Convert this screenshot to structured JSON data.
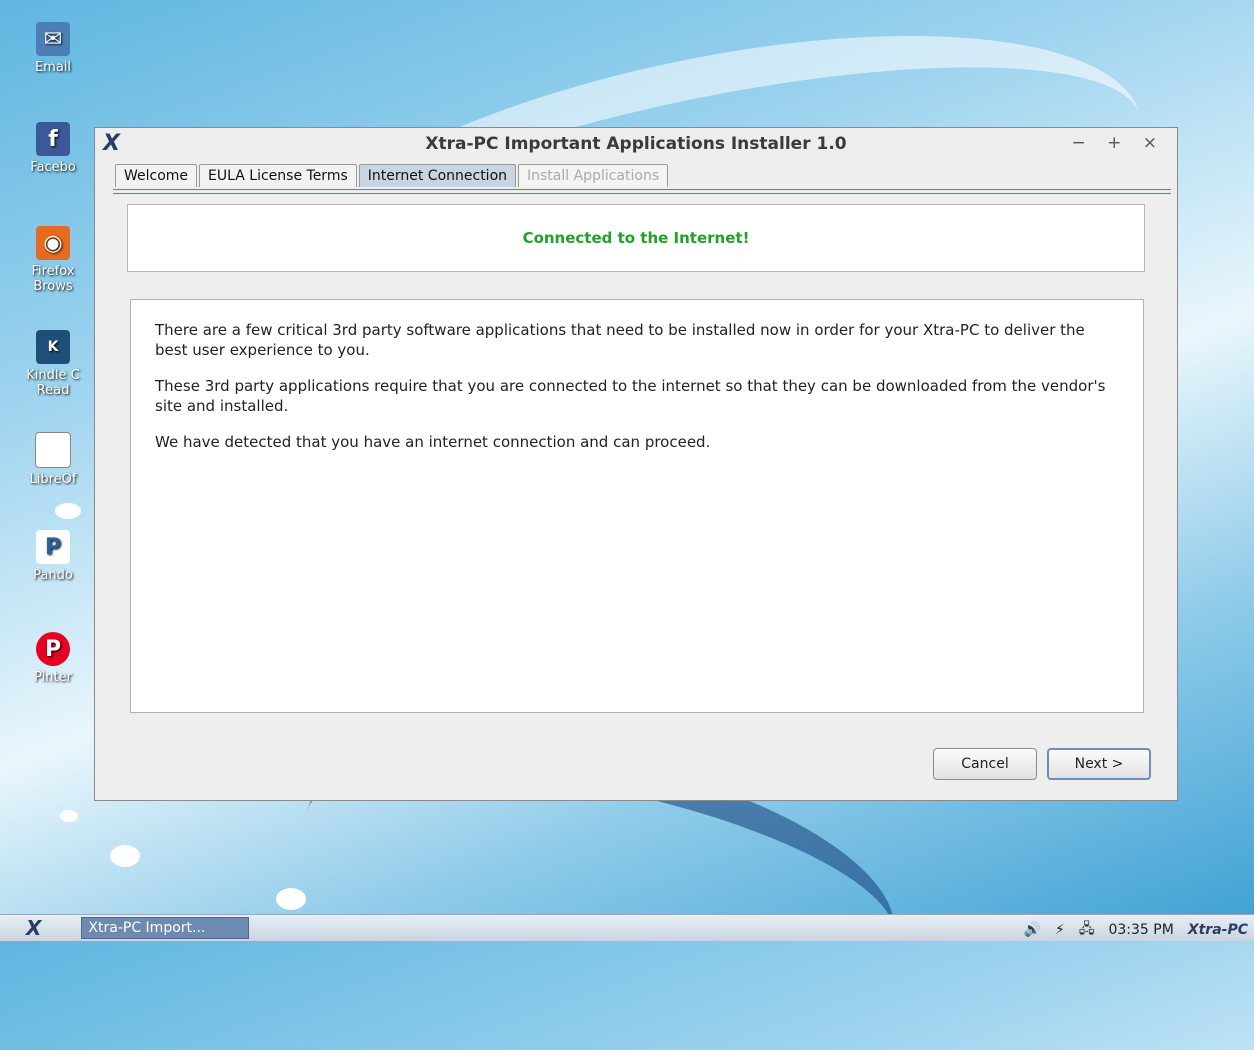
{
  "desktop": {
    "icons": [
      {
        "label": "Email",
        "icon": "email-icon"
      },
      {
        "label": "Facebo",
        "icon": "facebook-icon"
      },
      {
        "label": "Firefox\nBrows",
        "icon": "firefox-icon"
      },
      {
        "label": "Kindle C\nRead",
        "icon": "kindle-icon"
      },
      {
        "label": "LibreOf",
        "icon": "libreoffice-icon"
      },
      {
        "label": "Pando",
        "icon": "pandora-icon"
      },
      {
        "label": "Pinter",
        "icon": "pinterest-icon"
      }
    ]
  },
  "window": {
    "title": "Xtra-PC Important Applications Installer 1.0",
    "controls": {
      "minimize": "−",
      "maximize": "+",
      "close": "×"
    },
    "tabs": [
      {
        "label": "Welcome",
        "state": "normal"
      },
      {
        "label": "EULA License Terms",
        "state": "normal"
      },
      {
        "label": "Internet Connection",
        "state": "active"
      },
      {
        "label": "Install Applications",
        "state": "disabled"
      }
    ],
    "status": "Connected to the Internet!",
    "status_color": "#22a02a",
    "paragraphs": [
      "There are a few critical 3rd party software applications that need to be installed now in order for your Xtra-PC to deliver the best user experience to you.",
      "These 3rd party applications require that you are connected to the internet so that they can be downloaded from the vendor's site and installed.",
      "We have detected that you have an internet connection and can proceed."
    ],
    "buttons": {
      "cancel": "Cancel",
      "next": "Next >"
    }
  },
  "taskbar": {
    "task_label": "Xtra-PC Import...",
    "time": "03:35 PM",
    "brand": "Xtra-PC"
  }
}
